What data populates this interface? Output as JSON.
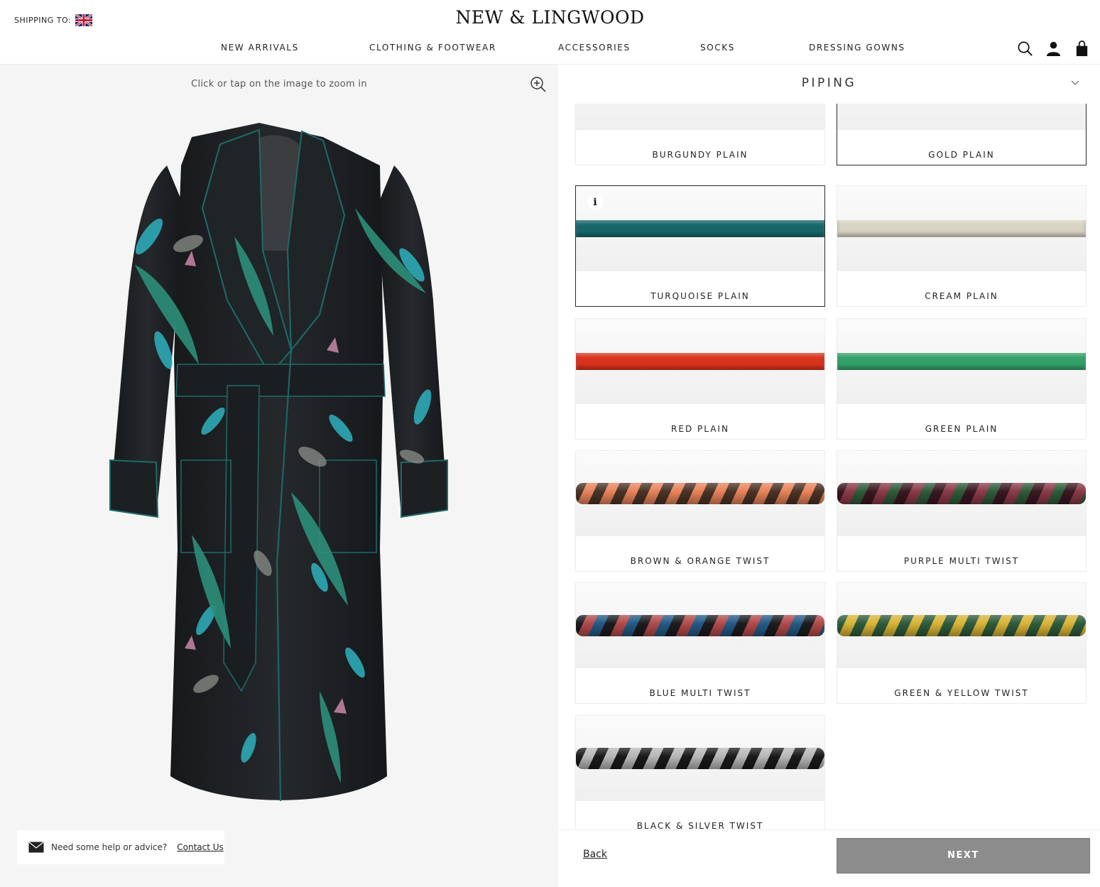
{
  "header": {
    "shipping_label": "SHIPPING TO:",
    "logo": "NEW & LINGWOOD",
    "nav": [
      "NEW ARRIVALS",
      "CLOTHING & FOOTWEAR",
      "ACCESSORIES",
      "SOCKS",
      "DRESSING GOWNS"
    ],
    "icons": [
      "search-icon",
      "account-icon",
      "bag-icon"
    ]
  },
  "preview": {
    "zoom_hint": "Click or tap on the image to zoom in"
  },
  "help": {
    "text": "Need some help or advice?",
    "link": "Contact Us"
  },
  "section": {
    "title": "PIPING"
  },
  "options": [
    {
      "label": "BURGUNDY PLAIN",
      "color": "#5a1a22",
      "kind": "plain",
      "selected": false
    },
    {
      "label": "GOLD PLAIN",
      "color": "#8a7330",
      "kind": "plain",
      "selected": true
    },
    {
      "label": "TURQUOISE PLAIN",
      "color": "#17666a",
      "kind": "plain",
      "selected": true,
      "info": "i"
    },
    {
      "label": "CREAM PLAIN",
      "color": "#d9d3c3",
      "kind": "plain",
      "selected": false
    },
    {
      "label": "RED PLAIN",
      "color": "#d9321c",
      "kind": "plain",
      "selected": false
    },
    {
      "label": "GREEN PLAIN",
      "color": "#33a06a",
      "kind": "plain",
      "selected": false
    },
    {
      "label": "BROWN & ORANGE TWIST",
      "colors": [
        "#4a3326",
        "#e8835a"
      ],
      "kind": "twist",
      "selected": false
    },
    {
      "label": "PURPLE MULTI TWIST",
      "colors": [
        "#3a1820",
        "#8a3a48",
        "#2f5a3a"
      ],
      "kind": "twist",
      "selected": false
    },
    {
      "label": "BLUE MULTI TWIST",
      "colors": [
        "#1c1c1f",
        "#b24a4a",
        "#255a86"
      ],
      "kind": "twist",
      "selected": false
    },
    {
      "label": "GREEN & YELLOW TWIST",
      "colors": [
        "#2f5b3c",
        "#d8b437"
      ],
      "kind": "twist",
      "selected": false
    },
    {
      "label": "BLACK & SILVER TWIST",
      "colors": [
        "#1a1a1a",
        "#b8b8b8"
      ],
      "kind": "twist",
      "selected": false
    }
  ],
  "footer": {
    "back": "Back",
    "next": "NEXT"
  }
}
